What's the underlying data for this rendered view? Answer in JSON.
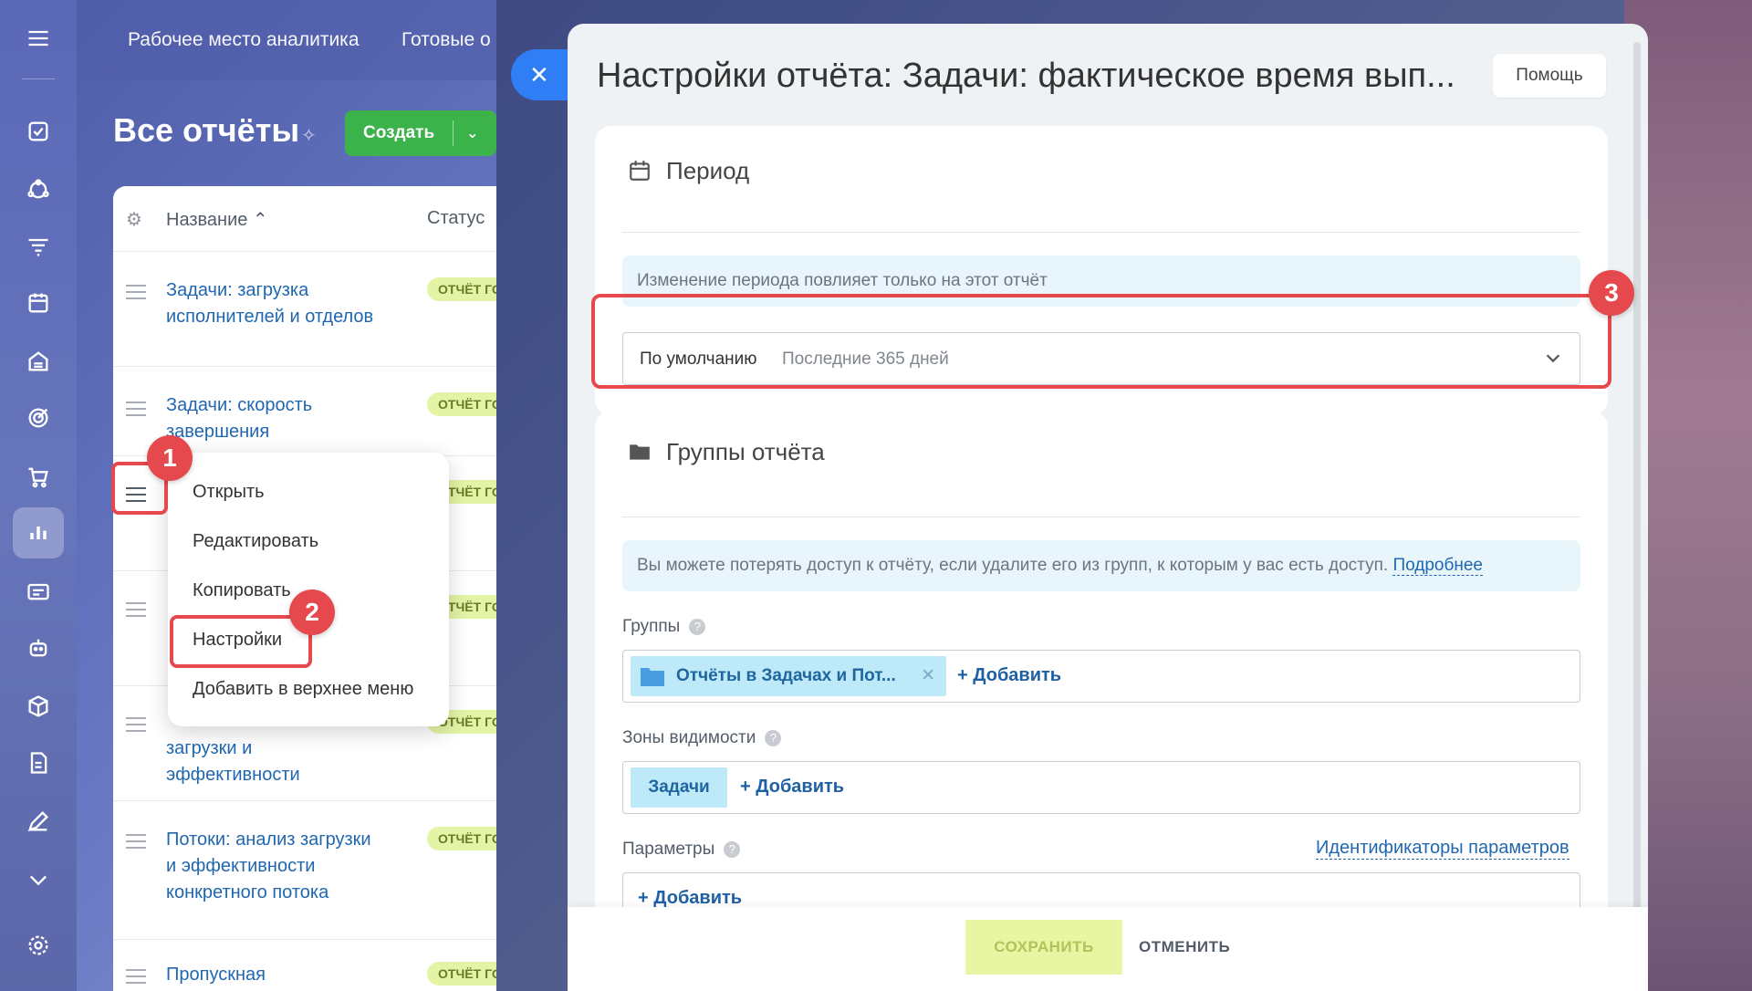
{
  "topnav": {
    "items": [
      "Рабочее место аналитика",
      "Готовые о"
    ]
  },
  "page": {
    "title": "Все отчёты",
    "create_label": "Создать"
  },
  "list": {
    "col_name": "Название",
    "col_status": "Статус",
    "rows": [
      {
        "title": "Задачи: загрузка исполнителей и отделов",
        "badge": "ОТЧЁТ ГОТ"
      },
      {
        "title": "Задачи: скорость завершения",
        "badge": "ОТЧЁТ ГОТ"
      },
      {
        "title": "",
        "badge": "ОТЧЁТ ГОТ"
      },
      {
        "title": "",
        "badge": "ОТЧЁТ ГОТ"
      },
      {
        "title": "загрузки и эффективности",
        "badge": "ОТЧЁТ ГОТ"
      },
      {
        "title": "Потоки: анализ загрузки и эффективности конкретного потока",
        "badge": "ОТЧЁТ ГОТ"
      },
      {
        "title": "Пропускная",
        "badge": "ОТЧЁТ ГОТ"
      }
    ]
  },
  "menu": {
    "items": [
      "Открыть",
      "Редактировать",
      "Копировать",
      "Настройки",
      "Добавить в верхнее меню"
    ]
  },
  "steps": {
    "one": "1",
    "two": "2",
    "three": "3"
  },
  "panel": {
    "title": "Настройки отчёта: Задачи: фактическое время вып...",
    "help": "Помощь",
    "period": {
      "title": "Период",
      "info": "Изменение периода повлияет только на этот отчёт",
      "select_key": "По умолчанию",
      "select_value": "Последние 365 дней"
    },
    "groups": {
      "title": "Группы отчёта",
      "info": "Вы можете потерять доступ к отчёту, если удалите его из групп, к которым у вас есть доступ.",
      "info_link": "Подробнее",
      "groups_label": "Группы",
      "group_tag": "Отчёты в Задачах и Пот...",
      "add": "+ Добавить",
      "zones_label": "Зоны видимости",
      "zone_tag": "Задачи",
      "params_label": "Параметры",
      "params_link": "Идентификаторы параметров"
    },
    "footer": {
      "save": "СОХРАНИТЬ",
      "cancel": "ОТМЕНИТЬ"
    }
  },
  "colors": {
    "accent": "#2f7ef5",
    "highlight": "#e5484d",
    "create": "#3bb34a"
  }
}
